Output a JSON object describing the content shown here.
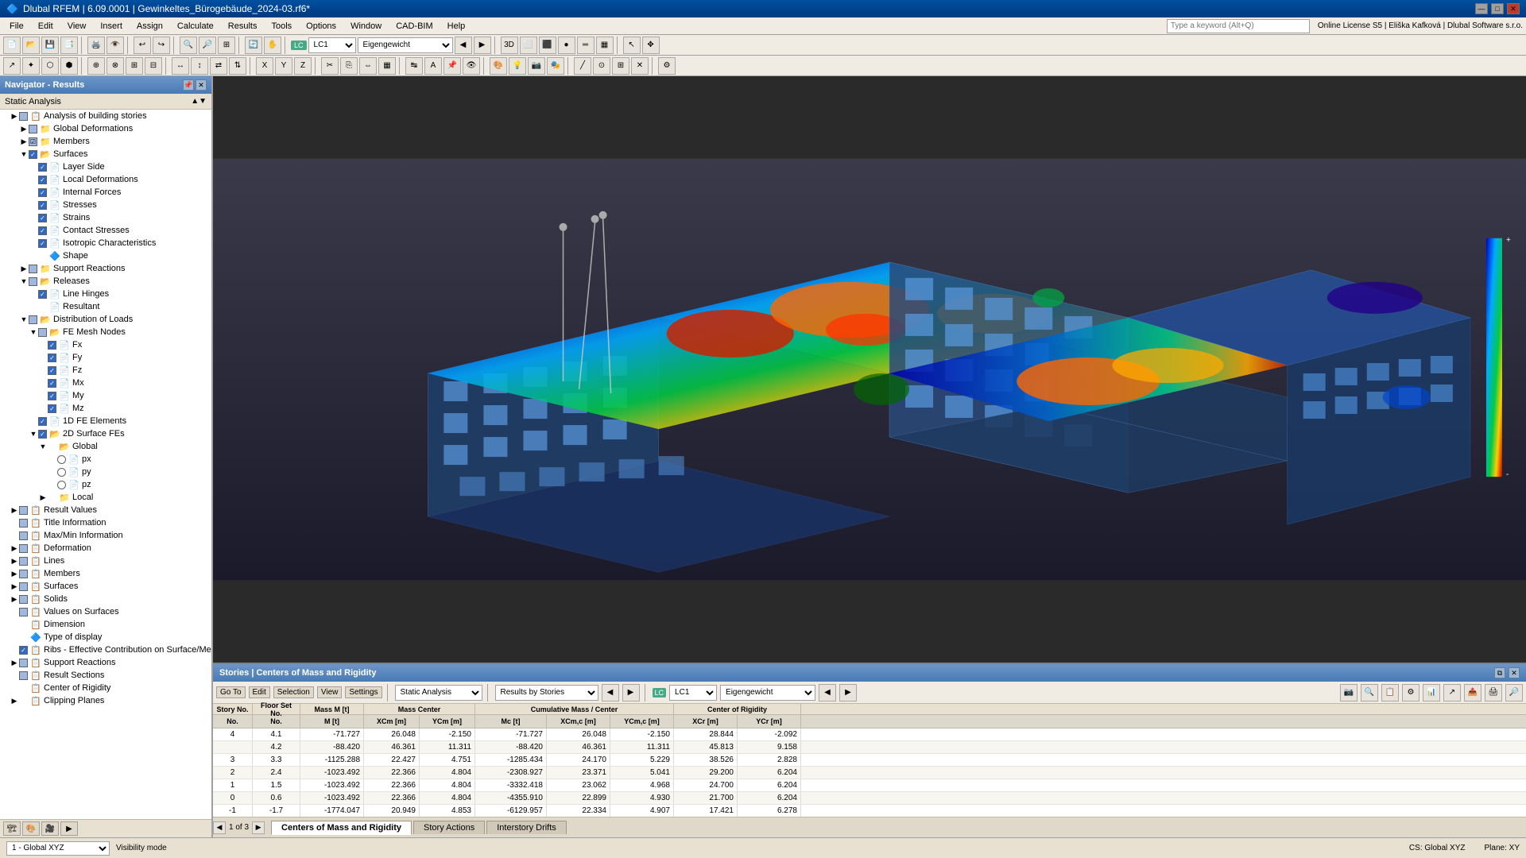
{
  "app": {
    "title": "Dlubal RFEM | 6.09.0001 | Gewinkeltes_Bürogebäude_2024-03.rf6*",
    "icon": "🔷"
  },
  "titlebar": {
    "minimize": "—",
    "maximize": "□",
    "close": "✕"
  },
  "menubar": {
    "items": [
      "File",
      "Edit",
      "View",
      "Insert",
      "Assign",
      "Calculate",
      "Results",
      "Tools",
      "Options",
      "Window",
      "CAD-BIM",
      "Help"
    ]
  },
  "toolbar_lc": {
    "lc_badge": "LC",
    "lc_number": "LC1",
    "lc_name": "Eigengewicht"
  },
  "navigator": {
    "title": "Navigator - Results",
    "sub_title": "Static Analysis",
    "tree": [
      {
        "label": "Analysis of building stories",
        "indent": 0,
        "expand": "▶",
        "cb": null,
        "icon": "📋"
      },
      {
        "label": "Global Deformations",
        "indent": 1,
        "expand": "▶",
        "cb": "partial",
        "icon": "📁"
      },
      {
        "label": "Members",
        "indent": 1,
        "expand": "▶",
        "cb": "partial",
        "icon": "📁"
      },
      {
        "label": "Surfaces",
        "indent": 1,
        "expand": "▼",
        "cb": "checked",
        "icon": "📂"
      },
      {
        "label": "Layer Side",
        "indent": 2,
        "expand": null,
        "cb": "checked",
        "icon": "📄"
      },
      {
        "label": "Local Deformations",
        "indent": 2,
        "expand": null,
        "cb": "checked",
        "icon": "📄"
      },
      {
        "label": "Internal Forces",
        "indent": 2,
        "expand": null,
        "cb": "checked",
        "icon": "📄"
      },
      {
        "label": "Stresses",
        "indent": 2,
        "expand": null,
        "cb": "checked",
        "icon": "📄"
      },
      {
        "label": "Strains",
        "indent": 2,
        "expand": null,
        "cb": "checked",
        "icon": "📄"
      },
      {
        "label": "Contact Stresses",
        "indent": 2,
        "expand": null,
        "cb": "checked",
        "icon": "📄"
      },
      {
        "label": "Isotropic Characteristics",
        "indent": 2,
        "expand": null,
        "cb": "checked",
        "icon": "📄"
      },
      {
        "label": "Shape",
        "indent": 2,
        "expand": null,
        "cb": null,
        "icon": "🔷"
      },
      {
        "label": "Support Reactions",
        "indent": 1,
        "expand": "▶",
        "cb": "partial",
        "icon": "📁"
      },
      {
        "label": "Releases",
        "indent": 1,
        "expand": "▼",
        "cb": "partial",
        "icon": "📂"
      },
      {
        "label": "Line Hinges",
        "indent": 2,
        "expand": null,
        "cb": "checked",
        "icon": "📄"
      },
      {
        "label": "Resultant",
        "indent": 2,
        "expand": null,
        "cb": null,
        "icon": "📄"
      },
      {
        "label": "Distribution of Loads",
        "indent": 1,
        "expand": "▼",
        "cb": "partial",
        "icon": "📂"
      },
      {
        "label": "FE Mesh Nodes",
        "indent": 2,
        "expand": "▼",
        "cb": "partial",
        "icon": "📂"
      },
      {
        "label": "Fx",
        "indent": 3,
        "expand": null,
        "cb": "checked",
        "icon": "📄"
      },
      {
        "label": "Fy",
        "indent": 3,
        "expand": null,
        "cb": "checked",
        "icon": "📄"
      },
      {
        "label": "Fz",
        "indent": 3,
        "expand": null,
        "cb": "checked",
        "icon": "📄"
      },
      {
        "label": "Mx",
        "indent": 3,
        "expand": null,
        "cb": "checked",
        "icon": "📄"
      },
      {
        "label": "My",
        "indent": 3,
        "expand": null,
        "cb": "checked",
        "icon": "📄"
      },
      {
        "label": "Mz",
        "indent": 3,
        "expand": null,
        "cb": "checked",
        "icon": "📄"
      },
      {
        "label": "1D FE Elements",
        "indent": 2,
        "expand": null,
        "cb": "checked",
        "icon": "📄"
      },
      {
        "label": "2D Surface FEs",
        "indent": 2,
        "expand": "▼",
        "cb": "checked",
        "icon": "📂"
      },
      {
        "label": "Global",
        "indent": 3,
        "expand": "▼",
        "cb": null,
        "icon": "📂"
      },
      {
        "label": "px",
        "indent": 4,
        "expand": null,
        "cb": null,
        "radio": true,
        "icon": "📄"
      },
      {
        "label": "py",
        "indent": 4,
        "expand": null,
        "cb": null,
        "radio": true,
        "icon": "📄"
      },
      {
        "label": "pz",
        "indent": 4,
        "expand": null,
        "cb": null,
        "radio": true,
        "icon": "📄"
      },
      {
        "label": "Local",
        "indent": 3,
        "expand": "▶",
        "cb": null,
        "icon": "📁"
      },
      {
        "label": "Result Values",
        "indent": 0,
        "expand": "▶",
        "cb": "partial",
        "icon": "📋"
      },
      {
        "label": "Title Information",
        "indent": 0,
        "expand": null,
        "cb": "partial",
        "icon": "📋"
      },
      {
        "label": "Max/Min Information",
        "indent": 0,
        "expand": null,
        "cb": "partial",
        "icon": "📋"
      },
      {
        "label": "Deformation",
        "indent": 0,
        "expand": "▶",
        "cb": "partial",
        "icon": "📋"
      },
      {
        "label": "Lines",
        "indent": 0,
        "expand": "▶",
        "cb": "partial",
        "icon": "📋"
      },
      {
        "label": "Members",
        "indent": 0,
        "expand": "▶",
        "cb": "partial",
        "icon": "📋"
      },
      {
        "label": "Surfaces",
        "indent": 0,
        "expand": "▶",
        "cb": "partial",
        "icon": "📋"
      },
      {
        "label": "Solids",
        "indent": 0,
        "expand": "▶",
        "cb": "partial",
        "icon": "📋"
      },
      {
        "label": "Values on Surfaces",
        "indent": 0,
        "expand": null,
        "cb": "partial",
        "icon": "📋"
      },
      {
        "label": "Dimension",
        "indent": 0,
        "expand": null,
        "cb": null,
        "icon": "📋"
      },
      {
        "label": "Type of display",
        "indent": 0,
        "expand": null,
        "cb": null,
        "icon": "🔷"
      },
      {
        "label": "Ribs - Effective Contribution on Surface/Member",
        "indent": 0,
        "expand": null,
        "cb": "checked",
        "icon": "📋"
      },
      {
        "label": "Support Reactions",
        "indent": 0,
        "expand": "▶",
        "cb": "partial",
        "icon": "📋"
      },
      {
        "label": "Result Sections",
        "indent": 0,
        "expand": null,
        "cb": "partial",
        "icon": "📋"
      },
      {
        "label": "Center of Rigidity",
        "indent": 0,
        "expand": null,
        "cb": null,
        "icon": "📋"
      },
      {
        "label": "Clipping Planes",
        "indent": 0,
        "expand": "▶",
        "cb": null,
        "icon": "📋"
      }
    ]
  },
  "bottom_panel": {
    "title": "Stories | Centers of Mass and Rigidity",
    "close_btn": "✕",
    "float_btn": "⧉",
    "toolbar": {
      "go_to": "Go To",
      "edit": "Edit",
      "selection": "Selection",
      "view": "View",
      "settings": "Settings",
      "analysis_type": "Static Analysis",
      "results_by": "Results by Stories",
      "lc_badge": "LC",
      "lc_number": "LC1",
      "lc_name": "Eigengewicht"
    },
    "table_headers": {
      "story_no": "Story No.",
      "floor_set_no": "Floor Set No.",
      "mass_m": "Mass M [t]",
      "mass_center": "Mass Center",
      "xCm": "XCm [m]",
      "yCm": "YCm [m]",
      "cumulative_mass": "Cumulative Mass / Center",
      "Mc": "Mc [t]",
      "xCmc": "XCm,c [m]",
      "yCmc": "YCm,c [m]",
      "center_rigidity": "Center of Rigidity",
      "xCr": "XCr [m]",
      "yCr": "YCr [m]"
    },
    "rows": [
      {
        "story": "4",
        "floor": "4.1",
        "mass": "-71.727",
        "xcm": "26.048",
        "ycm": "-2.150",
        "mc": "-71.727",
        "xcmc": "26.048",
        "ycmc": "-2.150",
        "xcr": "28.844",
        "ycr": "-2.092"
      },
      {
        "story": "",
        "floor": "4.2",
        "mass": "-88.420",
        "xcm": "46.361",
        "ycm": "11.311",
        "mc": "-88.420",
        "xcmc": "46.361",
        "ycmc": "11.311",
        "xcr": "45.813",
        "ycr": "9.158"
      },
      {
        "story": "3",
        "floor": "3.3",
        "mass": "-1125.288",
        "xcm": "22.427",
        "ycm": "4.751",
        "mc": "-1285.434",
        "xcmc": "24.170",
        "ycmc": "5.229",
        "xcr": "38.526",
        "ycr": "2.828"
      },
      {
        "story": "2",
        "floor": "2.4",
        "mass": "-1023.492",
        "xcm": "22.366",
        "ycm": "4.804",
        "mc": "-2308.927",
        "xcmc": "23.371",
        "ycmc": "5.041",
        "xcr": "29.200",
        "ycr": "6.204"
      },
      {
        "story": "1",
        "floor": "1.5",
        "mass": "-1023.492",
        "xcm": "22.366",
        "ycm": "4.804",
        "mc": "-3332.418",
        "xcmc": "23.062",
        "ycmc": "4.968",
        "xcr": "24.700",
        "ycr": "6.204"
      },
      {
        "story": "0",
        "floor": "0.6",
        "mass": "-1023.492",
        "xcm": "22.366",
        "ycm": "4.804",
        "mc": "-4355.910",
        "xcmc": "22.899",
        "ycmc": "4.930",
        "xcr": "21.700",
        "ycr": "6.204"
      },
      {
        "story": "-1",
        "floor": "-1.7",
        "mass": "-1774.047",
        "xcm": "20.949",
        "ycm": "4.853",
        "mc": "-6129.957",
        "xcmc": "22.334",
        "ycmc": "4.907",
        "xcr": "17.421",
        "ycr": "6.278"
      }
    ],
    "page_info": "1 of 3",
    "tabs": [
      "Centers of Mass and Rigidity",
      "Story Actions",
      "Interstory Drifts"
    ]
  },
  "statusbar": {
    "model_combo": "1 - Global XYZ",
    "cs_label": "CS: Global XYZ",
    "plane_label": "Plane: XY",
    "visibility": "Visibility mode"
  }
}
